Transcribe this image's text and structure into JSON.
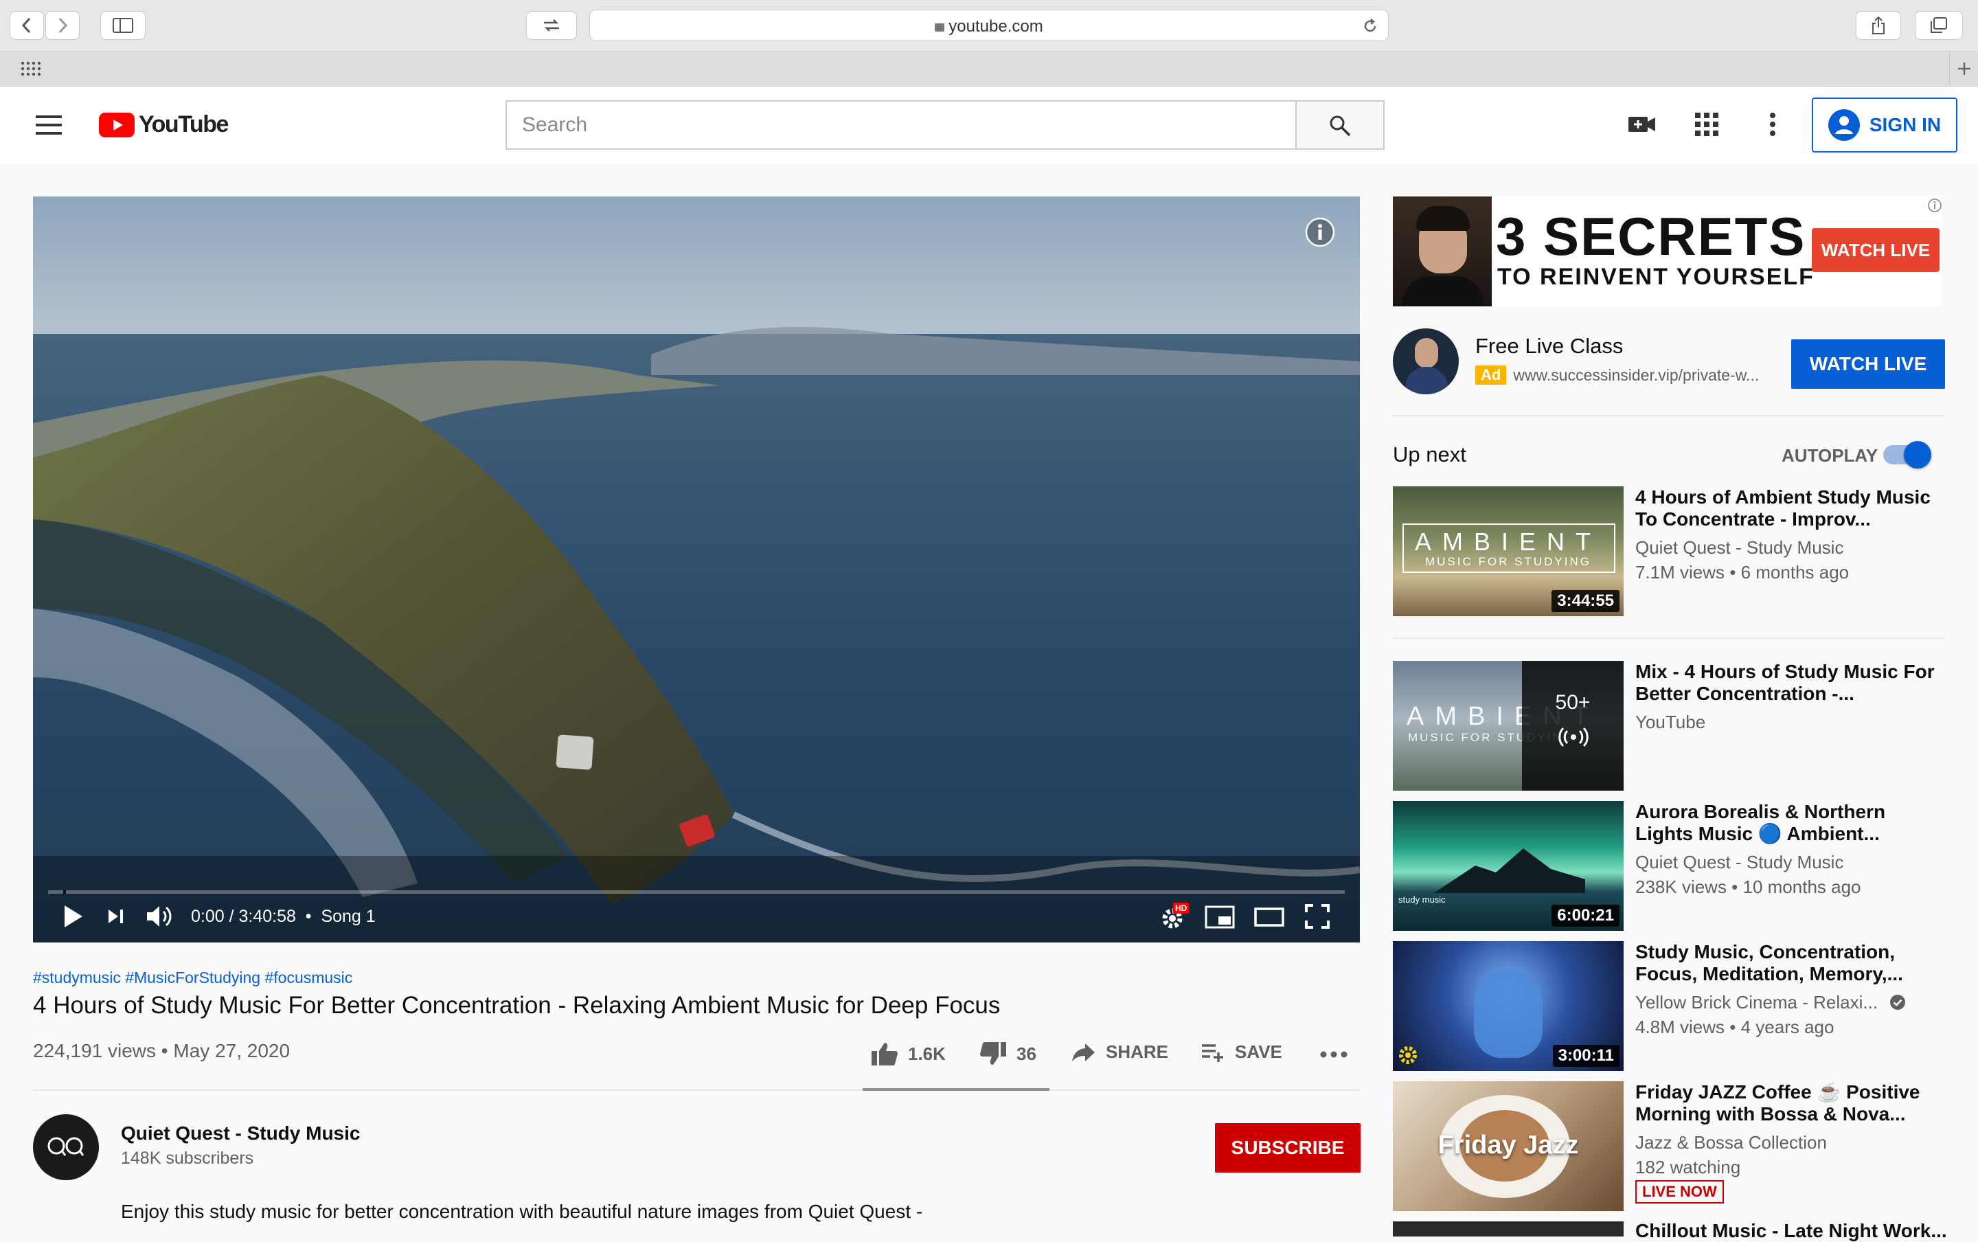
{
  "browser": {
    "url": "youtube.com"
  },
  "header": {
    "logo_text": "YouTube",
    "search_placeholder": "Search",
    "sign_in_label": "SIGN IN"
  },
  "player": {
    "time": "0:00 / 3:40:58",
    "chapter": "Song 1",
    "progress": 0.0,
    "hd_badge": "HD"
  },
  "video": {
    "hashtags": [
      "#studymusic",
      "#MusicForStudying",
      "#focusmusic"
    ],
    "title": "4 Hours of Study Music For Better Concentration - Relaxing Ambient Music for Deep Focus",
    "views": "224,191 views",
    "date": "May 27, 2020",
    "likes": "1.6K",
    "dislikes": "36",
    "share_label": "SHARE",
    "save_label": "SAVE"
  },
  "channel": {
    "name": "Quiet Quest - Study Music",
    "subscribers": "148K subscribers",
    "subscribe_label": "SUBSCRIBE",
    "description": "Enjoy this study music for better concentration with beautiful nature images from Quiet Quest -"
  },
  "ad": {
    "banner_line1": "3 SECRETS",
    "banner_line2": "TO REINVENT YOURSELF",
    "banner_button": "WATCH LIVE",
    "title": "Free Live Class",
    "badge": "Ad",
    "url": "www.successinsider.vip/private-w...",
    "cta": "WATCH LIVE"
  },
  "sidebar": {
    "up_next": "Up next",
    "autoplay": "AUTOPLAY",
    "autoplay_on": true,
    "items": [
      {
        "title": "4 Hours of Ambient Study Music To Concentrate - Improv...",
        "channel": "Quiet Quest - Study Music",
        "meta": "7.1M views • 6 months ago",
        "duration": "3:44:55",
        "thumb_text": "AMBIENT",
        "thumb_sub": "MUSIC FOR STUDYING"
      },
      {
        "title": "Mix - 4 Hours of Study Music For Better Concentration -...",
        "channel": "YouTube",
        "count": "50+",
        "thumb_text": "AMBIENT",
        "thumb_sub": "MUSIC FOR STUDYING"
      },
      {
        "title": "Aurora Borealis & Northern Lights Music 🔵 Ambient...",
        "channel": "Quiet Quest - Study Music",
        "meta": "238K views • 10 months ago",
        "duration": "6:00:21",
        "thumb_logo": "study music"
      },
      {
        "title": "Study Music, Concentration, Focus, Meditation, Memory,...",
        "channel": "Yellow Brick Cinema - Relaxi...",
        "meta": "4.8M views • 4 years ago",
        "duration": "3:00:11"
      },
      {
        "title": "Friday JAZZ Coffee ☕ Positive Morning with Bossa & Nova...",
        "channel": "Jazz & Bossa Collection",
        "meta": "182 watching",
        "badge": "LIVE NOW",
        "thumb_text": "Friday Jazz"
      },
      {
        "title": "Chillout Music - Late Night Work..."
      }
    ]
  },
  "colors": {
    "brand_red": "#ff0000",
    "subscribe_red": "#cc0000",
    "link_blue": "#065fd4",
    "ad_yellow": "#f9b400"
  }
}
